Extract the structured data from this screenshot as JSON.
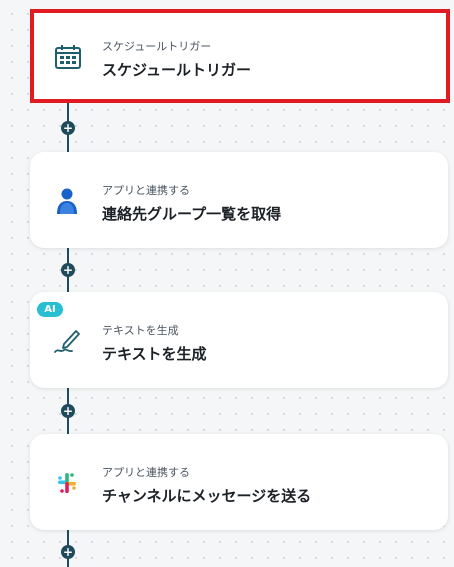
{
  "flow": {
    "steps": [
      {
        "subtitle": "スケジュールトリガー",
        "title": "スケジュールトリガー",
        "icon": "calendar-clock-icon"
      },
      {
        "subtitle": "アプリと連携する",
        "title": "連絡先グループ一覧を取得",
        "icon": "contact-person-icon"
      },
      {
        "subtitle": "テキストを生成",
        "title": "テキストを生成",
        "icon": "pen-icon",
        "badge": "AI"
      },
      {
        "subtitle": "アプリと連携する",
        "title": "チャンネルにメッセージを送る",
        "icon": "slack-icon"
      }
    ],
    "add_label": "+"
  },
  "colors": {
    "selection_border": "#e11b22",
    "connector": "#1f4b5c",
    "ai_badge": "#26c0d2",
    "icon_teal": "#1f5e6e",
    "person_blue": "#1a62c7"
  }
}
